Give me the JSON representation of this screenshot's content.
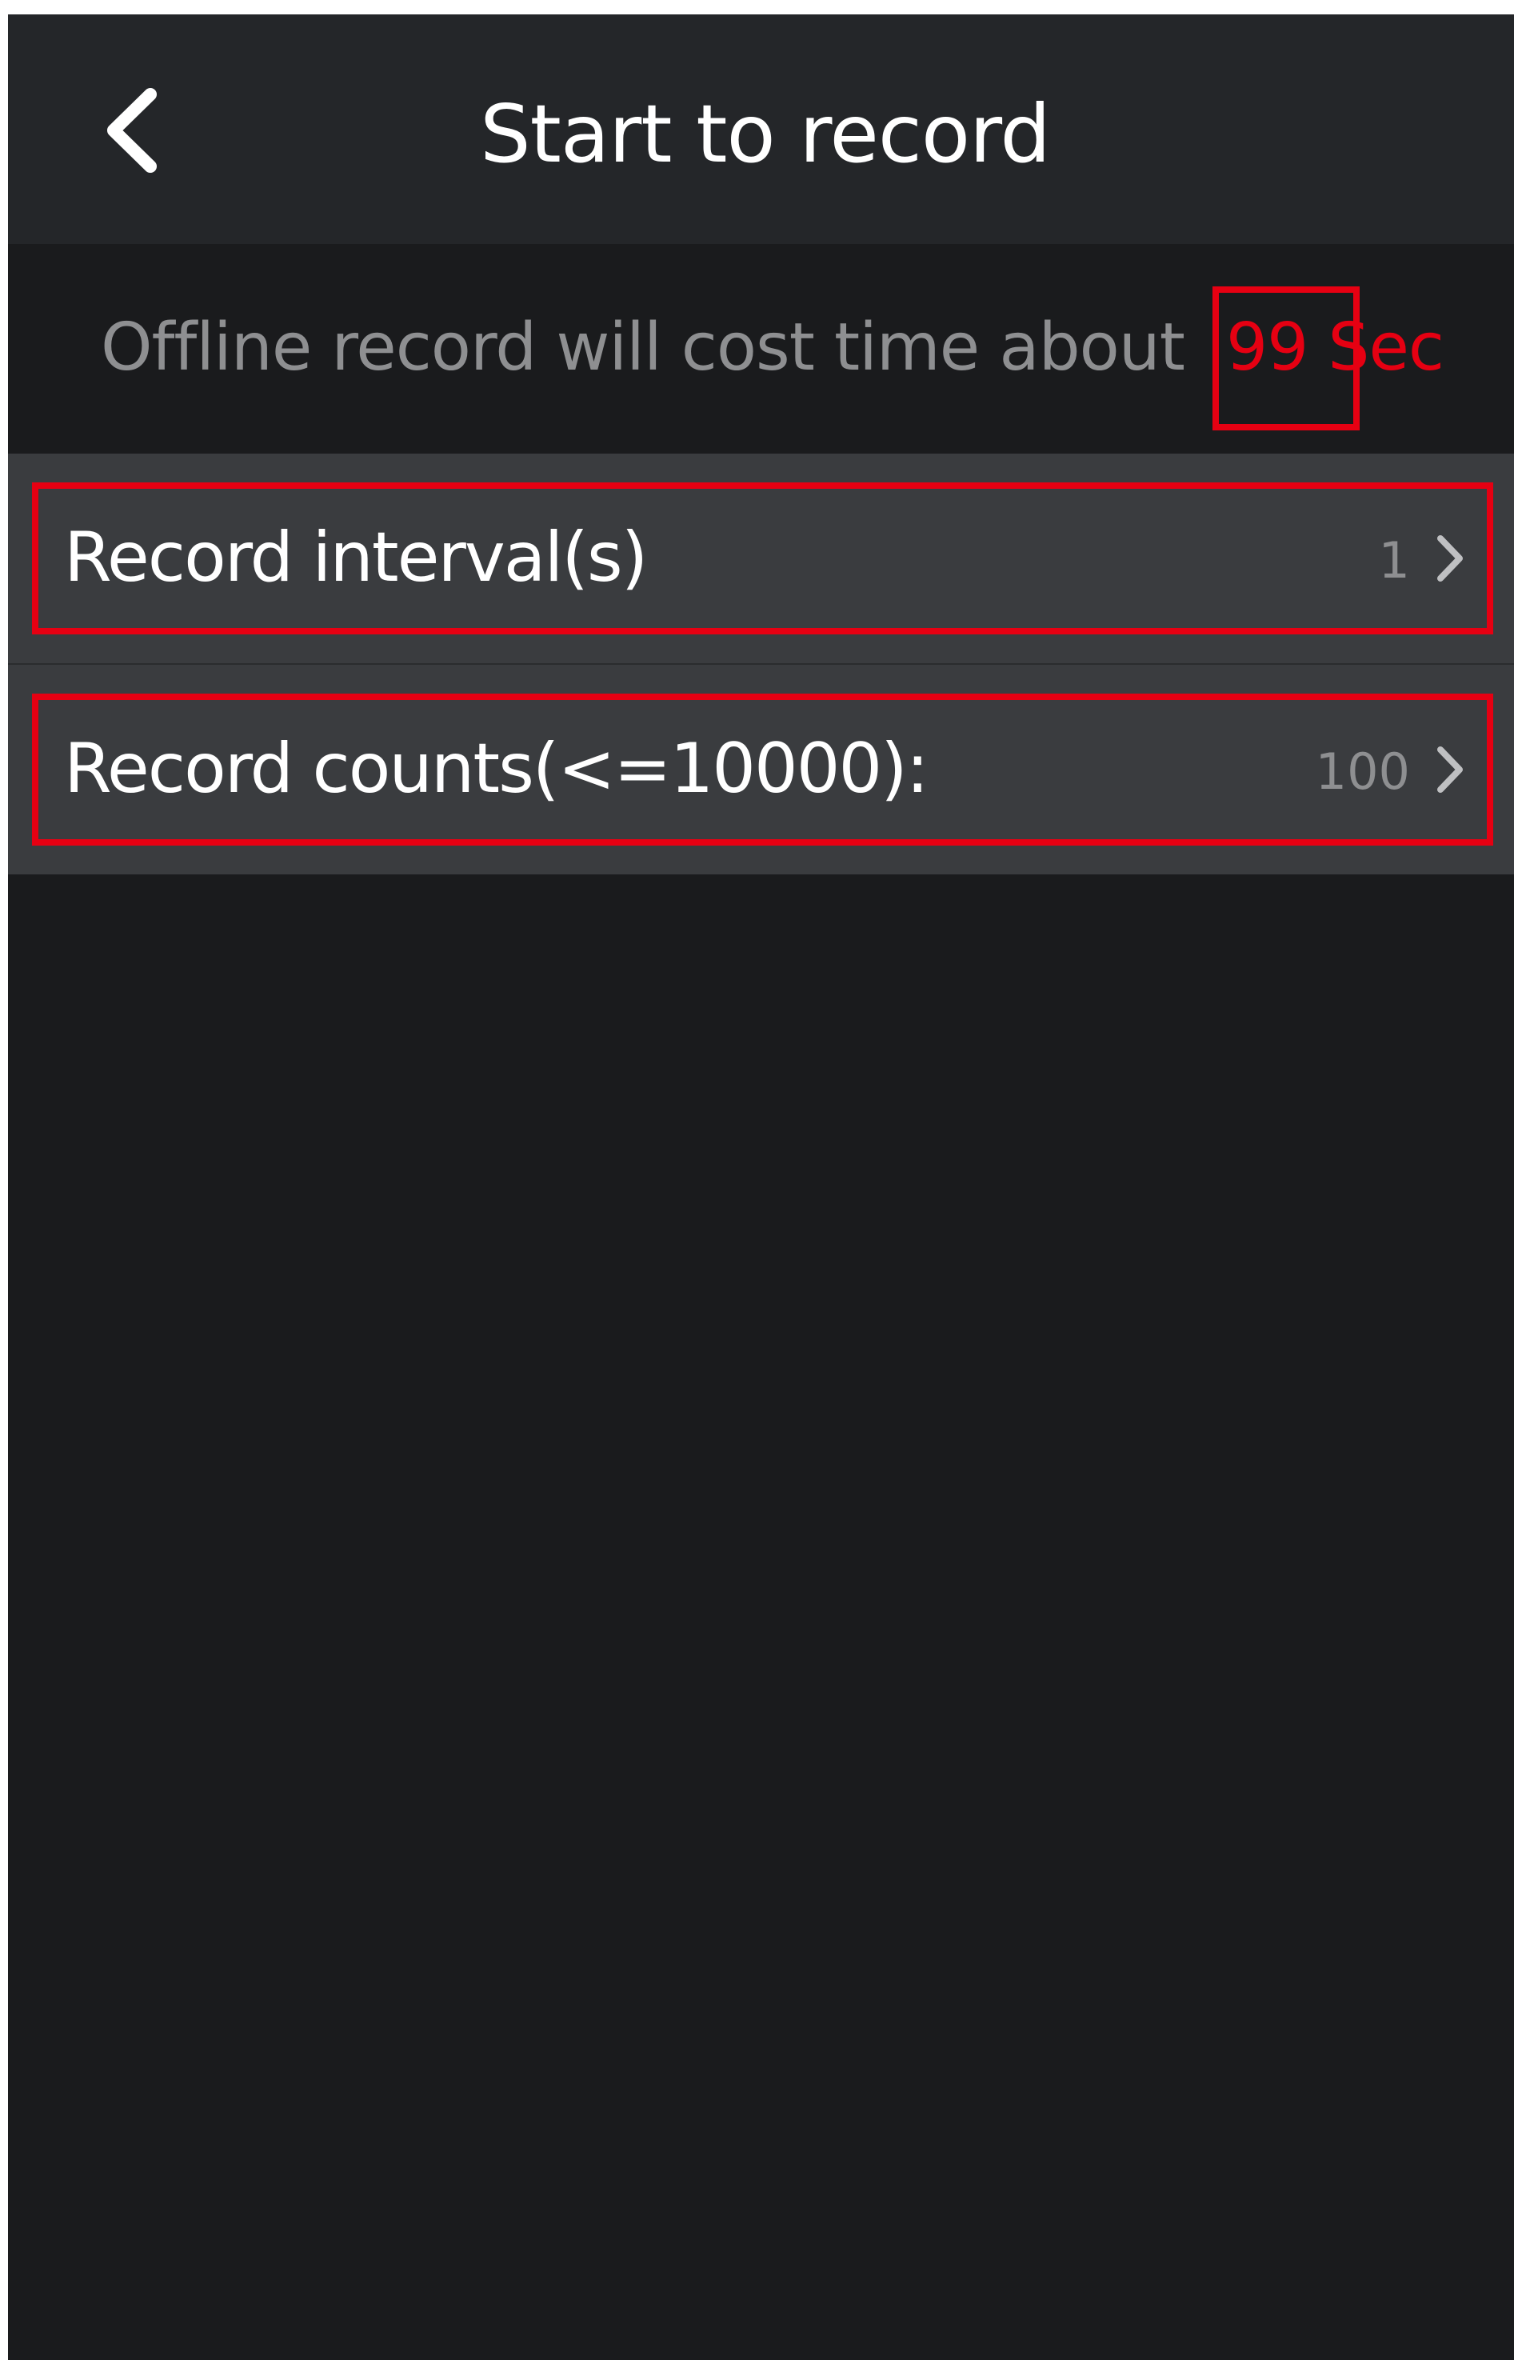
{
  "header": {
    "title": "Start to record",
    "back_icon": "chevron-left-icon"
  },
  "info": {
    "text": "Offline record will cost time about",
    "value": "99 Sec",
    "value_color": "#e60012"
  },
  "settings": {
    "interval": {
      "label": "Record interval(s)",
      "value": "1",
      "icon": "chevron-right-icon"
    },
    "counts": {
      "label": "Record counts(<=10000):",
      "value": "100",
      "icon": "chevron-right-icon"
    }
  },
  "colors": {
    "background": "#1a1b1d",
    "header": "#242629",
    "row": "#3a3c3f",
    "highlight": "#e60012",
    "muted_text": "#8e8f91"
  }
}
